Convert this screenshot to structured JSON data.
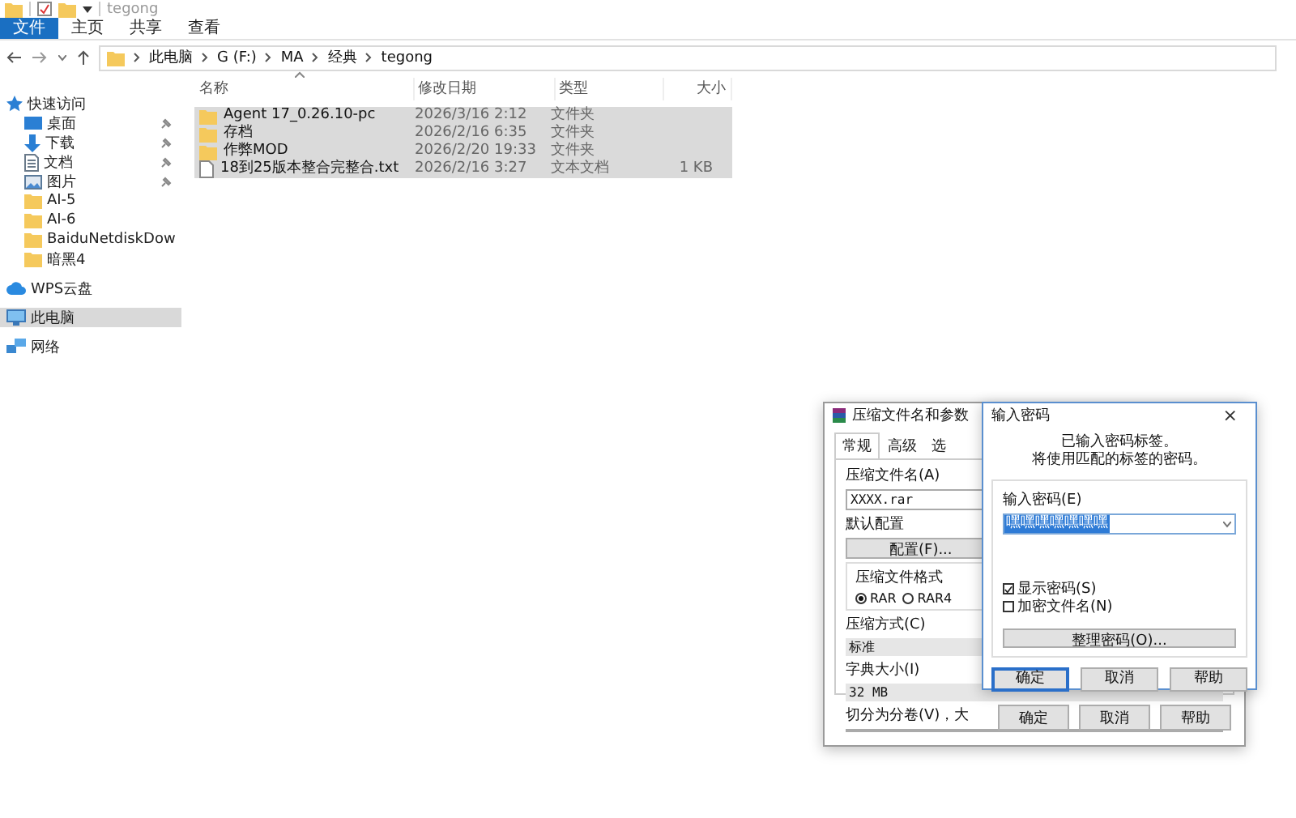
{
  "explorer": {
    "title": "tegong",
    "ribbon_tabs": [
      {
        "label": "文件",
        "selected": true
      },
      {
        "label": "主页",
        "selected": false
      },
      {
        "label": "共享",
        "selected": false
      },
      {
        "label": "查看",
        "selected": false
      }
    ],
    "path": [
      "此电脑",
      "G (F:)",
      "MA",
      "经典",
      "tegong"
    ],
    "sidebar": [
      {
        "label": "快速访问",
        "kind": "star",
        "pinned": false,
        "selected": false,
        "children": [
          {
            "label": "桌面",
            "kind": "desktop",
            "pinned": true,
            "selected": false
          },
          {
            "label": "下载",
            "kind": "download",
            "pinned": true,
            "selected": false
          },
          {
            "label": "文档",
            "kind": "document",
            "pinned": true,
            "selected": false
          },
          {
            "label": "图片",
            "kind": "pictures",
            "pinned": true,
            "selected": false
          },
          {
            "label": "AI-5",
            "kind": "folder",
            "pinned": false,
            "selected": false
          },
          {
            "label": "AI-6",
            "kind": "folder",
            "pinned": false,
            "selected": false
          },
          {
            "label": "BaiduNetdiskDow",
            "kind": "folder",
            "pinned": false,
            "selected": false
          },
          {
            "label": "暗黑4",
            "kind": "folder",
            "pinned": false,
            "selected": false
          }
        ]
      },
      {
        "label": "WPS云盘",
        "kind": "cloud",
        "pinned": false,
        "selected": false
      },
      {
        "label": "此电脑",
        "kind": "computer",
        "pinned": false,
        "selected": true
      },
      {
        "label": "网络",
        "kind": "network",
        "pinned": false,
        "selected": false
      }
    ],
    "columns": [
      "名称",
      "修改日期",
      "类型",
      "大小"
    ],
    "rows": [
      {
        "kind": "folder",
        "name": "Agent 17_0.26.10-pc",
        "date": "2026/3/16 2:12",
        "type": "文件夹",
        "selected": true
      },
      {
        "kind": "folder",
        "name": "存档",
        "date": "2026/2/16 6:35",
        "type": "文件夹",
        "selected": true
      },
      {
        "kind": "folder",
        "name": "作弊MOD",
        "date": "2026/2/20 19:33",
        "type": "文件夹",
        "selected": true
      },
      {
        "kind": "file",
        "name": "18到25版本整合完整合.txt",
        "date": "2026/2/16 3:27",
        "type": "文本文档",
        "size": "1 KB",
        "selected": true
      }
    ]
  },
  "archive_dialog": {
    "title": "压缩文件名和参数",
    "tabs": [
      {
        "label": "常规",
        "selected": true
      },
      {
        "label": "高级",
        "selected": false
      },
      {
        "label": "选",
        "selected": false
      }
    ],
    "archive_name_label": "压缩文件名(A)",
    "archive_name": "XXXX.rar",
    "profile_label": "默认配置",
    "profile_button": "配置(F)...",
    "format_group": "压缩文件格式",
    "formats": [
      {
        "label": "RAR",
        "selected": true
      },
      {
        "label": "RAR4",
        "selected": false
      }
    ],
    "method_label": "压缩方式(C)",
    "method": "标准",
    "dictionary_label": "字典大小(I)",
    "dictionary": "32 MB",
    "split_label": "切分为分卷(V)，大",
    "buttons": [
      "确定",
      "取消",
      "帮助"
    ]
  },
  "password_dialog": {
    "title": "输入密码",
    "close": "×",
    "message": [
      "已输入密码标签。",
      "将使用匹配的标签的密码。"
    ],
    "password_label": "输入密码(E)",
    "password": "嘿嘿嘿嘿嘿嘿嘿",
    "options": [
      {
        "label": "显示密码(S)",
        "checked": true
      },
      {
        "label": "加密文件名(N)",
        "checked": false
      }
    ],
    "organize_button": "整理密码(O)...",
    "buttons": [
      {
        "label": "确定",
        "default": true
      },
      {
        "label": "取消",
        "default": false
      },
      {
        "label": "帮助",
        "default": false
      }
    ]
  }
}
